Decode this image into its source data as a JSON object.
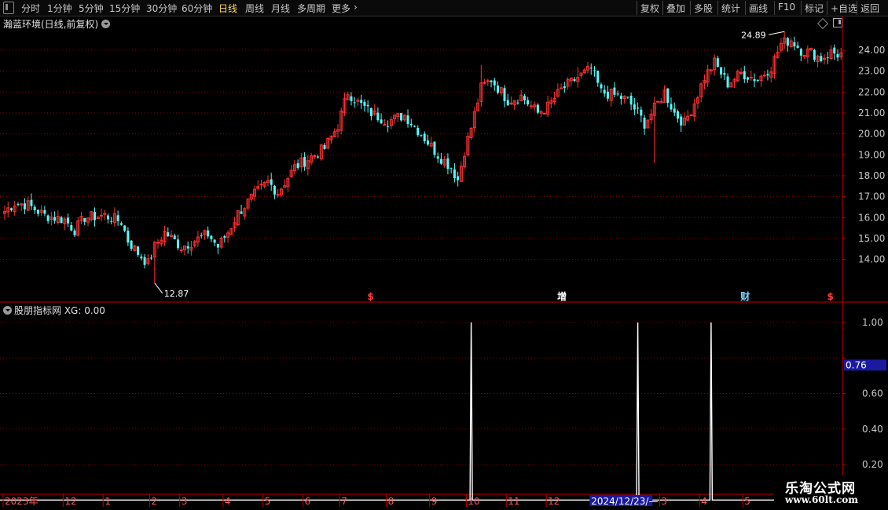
{
  "toolbar": {
    "left_items": [
      {
        "label": "分时",
        "active": false
      },
      {
        "label": "1分钟",
        "active": false
      },
      {
        "label": "5分钟",
        "active": false
      },
      {
        "label": "15分钟",
        "active": false
      },
      {
        "label": "30分钟",
        "active": false
      },
      {
        "label": "60分钟",
        "active": false
      },
      {
        "label": "日线",
        "active": true
      },
      {
        "label": "周线",
        "active": false
      },
      {
        "label": "月线",
        "active": false
      },
      {
        "label": "多周期",
        "active": false
      },
      {
        "label": "更多",
        "active": false
      }
    ],
    "more_icon": "chevron-right-icon",
    "right_items": [
      "复权",
      "叠加",
      "多股",
      "统计",
      "画线",
      "F10",
      "标记",
      "+自选",
      "返回"
    ]
  },
  "main_panel": {
    "title": "瀚蓝环境(日线,前复权)",
    "high_label": "24.89",
    "low_label": "12.87"
  },
  "sub_panel": {
    "title": "股朋指标网 XG: 0.00",
    "cursor_value": "0.76"
  },
  "event_markers": [
    {
      "label": "$",
      "x_index": 110,
      "color": "#ff4040"
    },
    {
      "label": "增",
      "x_index": 167,
      "color": "#ffffff"
    },
    {
      "label": "财",
      "x_index": 222,
      "color": "#7fd4ff"
    },
    {
      "label": "$",
      "x_index": 248,
      "color": "#ff4040"
    }
  ],
  "date_axis": {
    "labels": [
      {
        "label": "2023年",
        "x_index": 0
      },
      {
        "label": "12",
        "x_index": 18
      },
      {
        "label": "1",
        "x_index": 30
      },
      {
        "label": "2",
        "x_index": 44
      },
      {
        "label": "3",
        "x_index": 53
      },
      {
        "label": "4",
        "x_index": 66
      },
      {
        "label": "5",
        "x_index": 78
      },
      {
        "label": "6",
        "x_index": 90
      },
      {
        "label": "7",
        "x_index": 101
      },
      {
        "label": "8",
        "x_index": 115
      },
      {
        "label": "9",
        "x_index": 128
      },
      {
        "label": "10",
        "x_index": 139
      },
      {
        "label": "11",
        "x_index": 151
      },
      {
        "label": "12",
        "x_index": 163
      },
      {
        "label": "3",
        "x_index": 197
      },
      {
        "label": "4",
        "x_index": 209
      },
      {
        "label": "5",
        "x_index": 222
      }
    ],
    "cursor_label": "2024/12/23/—"
  },
  "watermark": {
    "title": "乐淘公式网",
    "url": "www.60lt.com"
  },
  "colors": {
    "up": "#ff3232",
    "down": "#54fcfc",
    "grid": "#8b0000",
    "axis": "#c00000",
    "signal": "#ffffff",
    "cursor_bg": "#1a1aa0"
  },
  "chart_data": [
    {
      "type": "candlestick",
      "title": "瀚蓝环境(日线,前复权)",
      "xlabel": "",
      "ylabel": "",
      "ylim": [
        13.2,
        24.9
      ],
      "yticks": [
        14.0,
        15.0,
        16.0,
        17.0,
        18.0,
        19.0,
        20.0,
        21.0,
        22.0,
        23.0,
        24.0
      ],
      "ytick_labels": [
        "14.00",
        "15.00",
        "16.00",
        "17.00",
        "18.00",
        "19.00",
        "20.00",
        "21.00",
        "22.00",
        "23.00",
        "24.00"
      ],
      "grid": true,
      "close_anchors": [
        [
          0,
          16.3
        ],
        [
          3,
          16.7
        ],
        [
          7,
          16.6
        ],
        [
          12,
          16.1
        ],
        [
          18,
          15.9
        ],
        [
          21,
          15.4
        ],
        [
          24,
          16.0
        ],
        [
          30,
          16.1
        ],
        [
          35,
          15.8
        ],
        [
          37,
          14.9
        ],
        [
          40,
          14.3
        ],
        [
          43,
          13.8
        ],
        [
          45,
          14.6
        ],
        [
          48,
          15.3
        ],
        [
          53,
          14.6
        ],
        [
          57,
          14.9
        ],
        [
          61,
          15.2
        ],
        [
          64,
          14.6
        ],
        [
          67,
          15.3
        ],
        [
          70,
          16.2
        ],
        [
          75,
          17.1
        ],
        [
          79,
          17.7
        ],
        [
          82,
          17.2
        ],
        [
          87,
          18.4
        ],
        [
          92,
          18.9
        ],
        [
          96,
          19.3
        ],
        [
          100,
          20.4
        ],
        [
          103,
          22.0
        ],
        [
          106,
          21.5
        ],
        [
          110,
          21.0
        ],
        [
          115,
          20.6
        ],
        [
          120,
          20.9
        ],
        [
          125,
          20.0
        ],
        [
          130,
          19.0
        ],
        [
          134,
          18.4
        ],
        [
          136,
          17.8
        ],
        [
          138,
          19.2
        ],
        [
          140,
          20.3
        ],
        [
          143,
          22.2
        ],
        [
          146,
          22.6
        ],
        [
          151,
          21.6
        ],
        [
          155,
          21.8
        ],
        [
          160,
          21.0
        ],
        [
          163,
          21.3
        ],
        [
          167,
          22.1
        ],
        [
          172,
          22.7
        ],
        [
          176,
          23.1
        ],
        [
          179,
          22.0
        ],
        [
          184,
          21.8
        ],
        [
          187,
          21.6
        ],
        [
          190,
          21.0
        ],
        [
          192,
          20.5
        ],
        [
          195,
          21.2
        ],
        [
          198,
          22.0
        ],
        [
          201,
          21.0
        ],
        [
          204,
          20.5
        ],
        [
          207,
          21.5
        ],
        [
          210,
          22.7
        ],
        [
          213,
          23.4
        ],
        [
          217,
          22.4
        ],
        [
          221,
          22.9
        ],
        [
          226,
          22.6
        ],
        [
          230,
          23.2
        ],
        [
          233,
          24.3
        ],
        [
          236,
          24.5
        ],
        [
          239,
          24.0
        ],
        [
          242,
          23.9
        ],
        [
          245,
          23.6
        ],
        [
          248,
          23.9
        ],
        [
          250,
          23.8
        ]
      ],
      "high": {
        "index": 234,
        "value": 24.89
      },
      "low": {
        "index": 45,
        "value": 12.87
      },
      "spikes": [
        {
          "index": 143,
          "high": 23.3
        },
        {
          "index": 195,
          "low": 18.6
        },
        {
          "index": 172,
          "high": 23.2
        }
      ]
    },
    {
      "type": "line",
      "title": "股朋指标网 XG: 0.00",
      "series": [
        {
          "name": "XG",
          "values": [
            {
              "x_index": 140,
              "y": 1.0
            },
            {
              "x_index": 190,
              "y": 1.0
            },
            {
              "x_index": 212,
              "y": 1.0
            }
          ]
        }
      ],
      "baseline": 0,
      "ylim": [
        0.05,
        1.04
      ],
      "yticks": [
        0.2,
        0.4,
        0.6,
        0.8,
        1.0
      ],
      "ytick_labels": [
        "0.20",
        "0.40",
        "0.60",
        "",
        "1.00"
      ],
      "grid": true
    }
  ]
}
